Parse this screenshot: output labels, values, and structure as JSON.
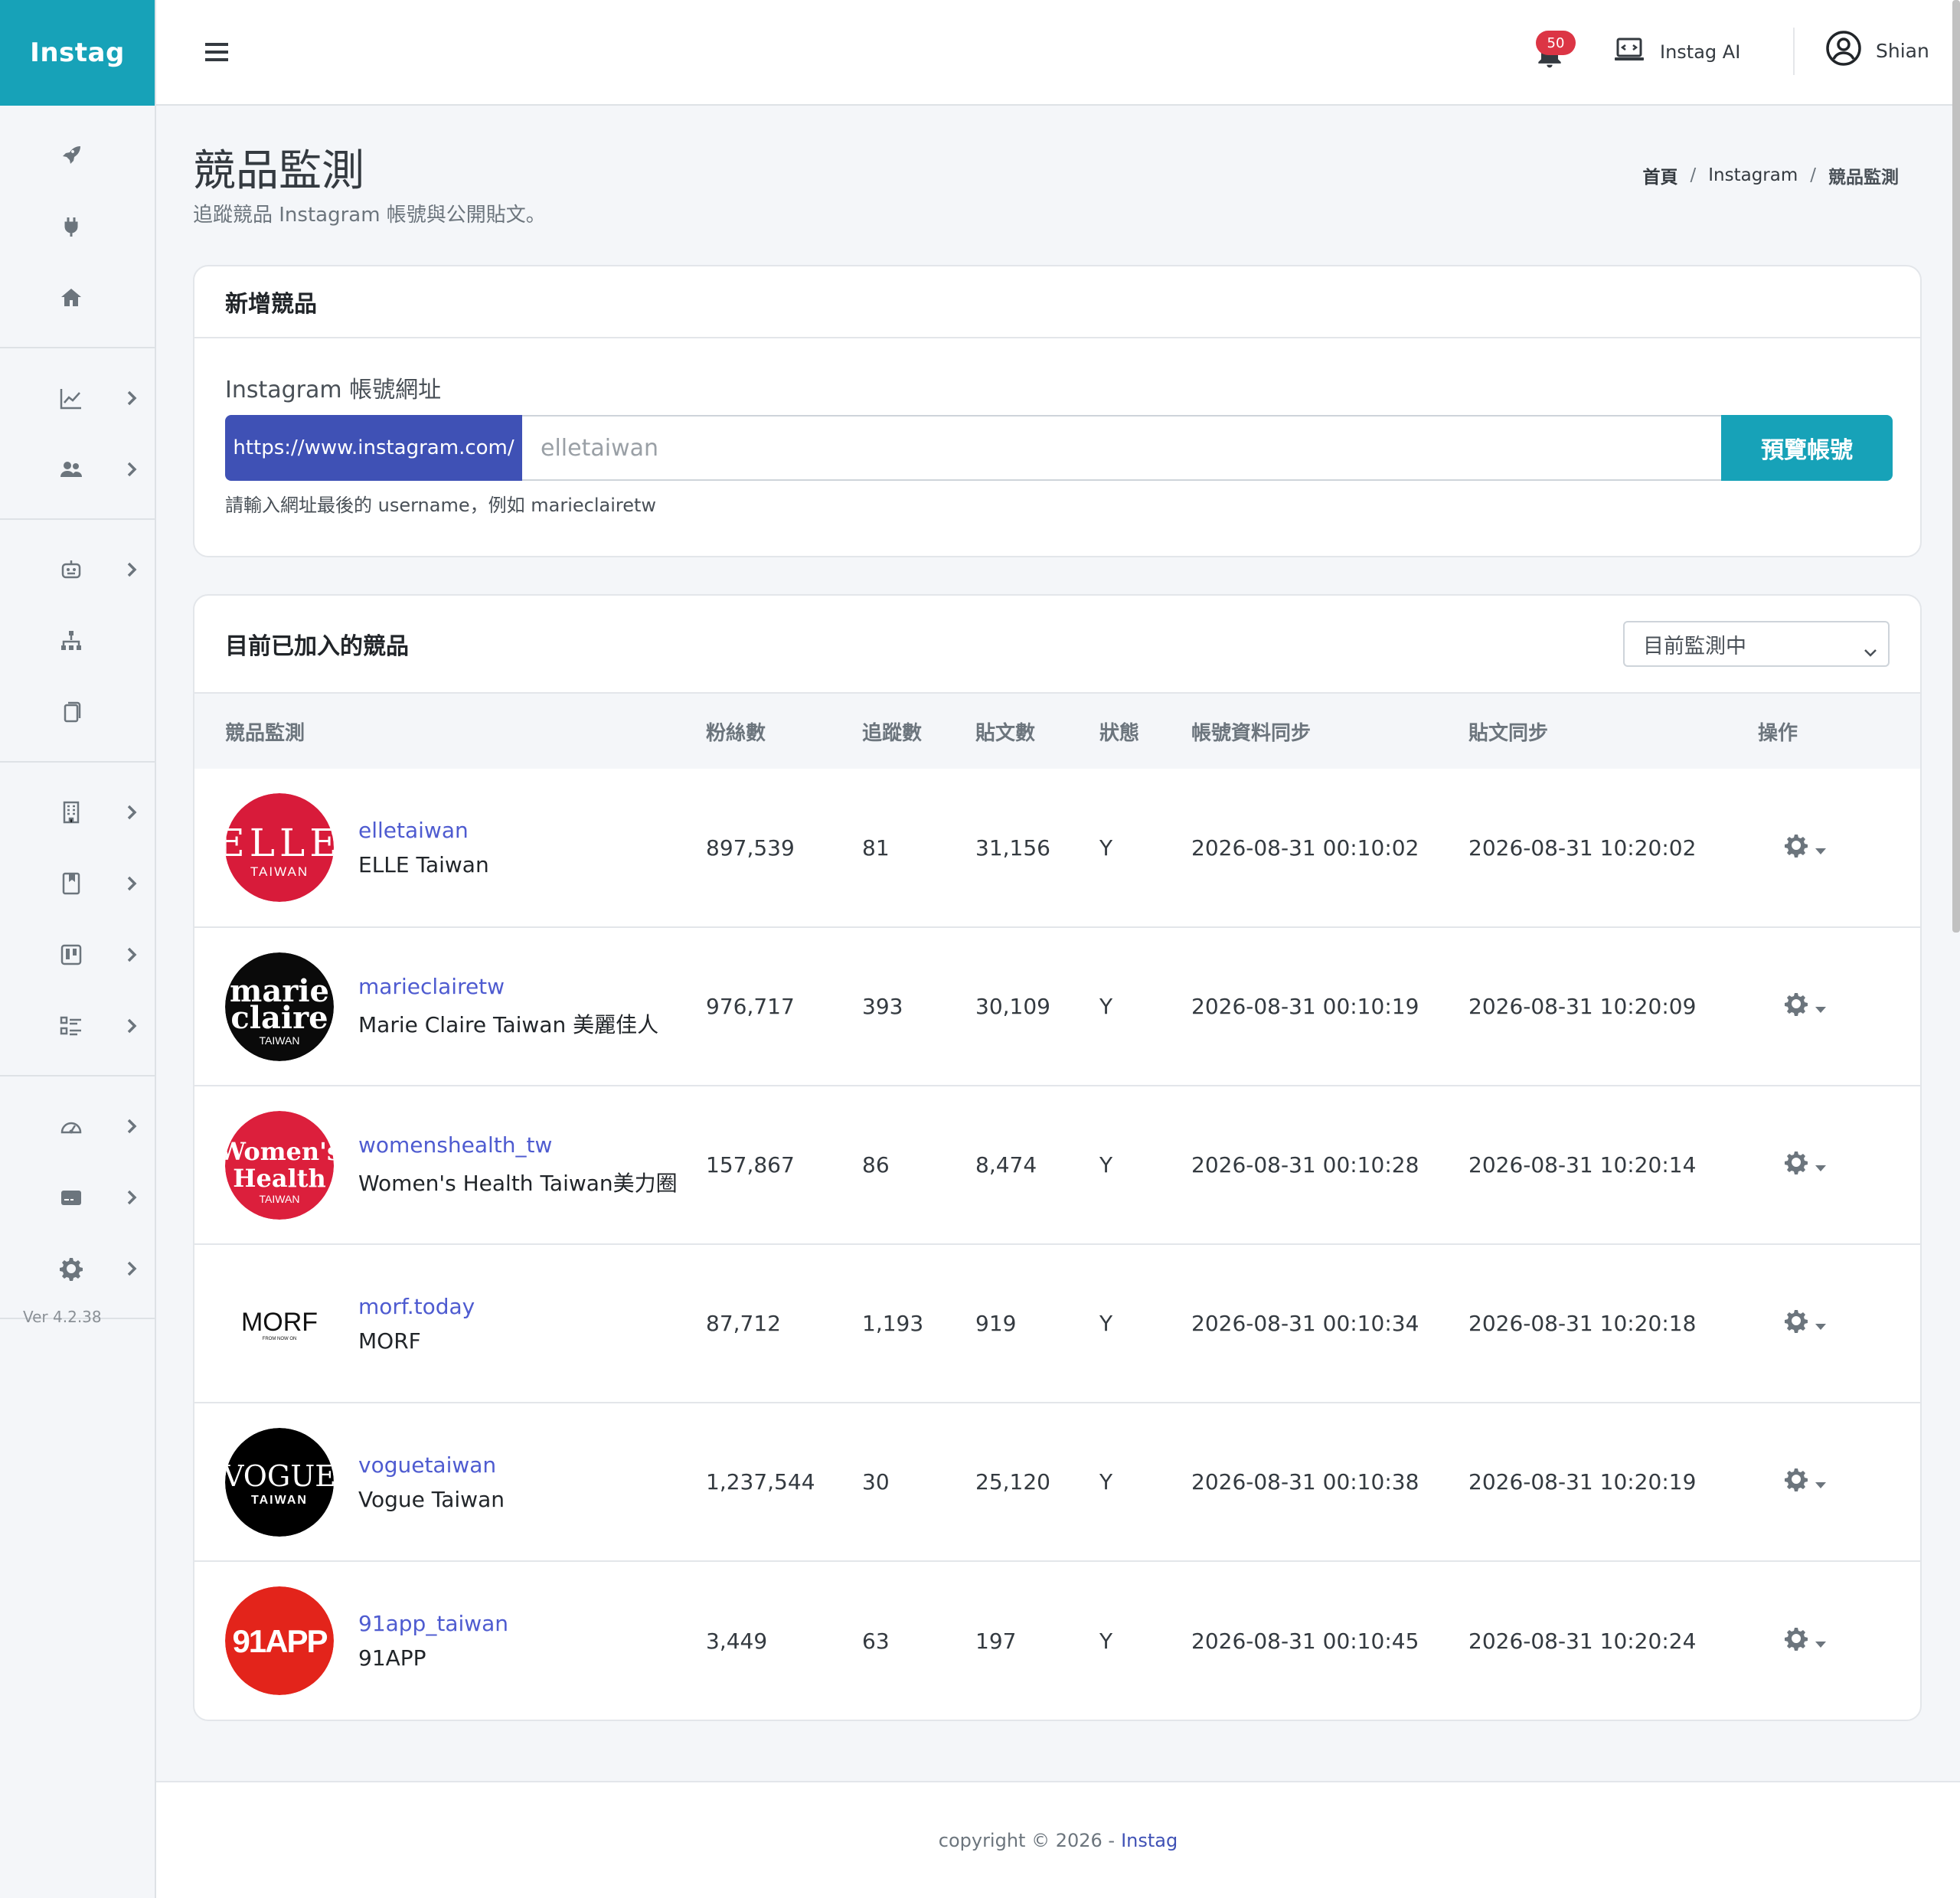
{
  "app": {
    "brand": "Instag",
    "version": "Ver 4.2.38"
  },
  "topbar": {
    "notification_count": "50",
    "ai_label": "Instag AI",
    "user_name": "Shian"
  },
  "sidebar": {
    "items": [
      {
        "icon": "rocket-icon",
        "chevron": false
      },
      {
        "icon": "plug-icon",
        "chevron": false
      },
      {
        "icon": "home-icon",
        "chevron": false
      },
      {
        "icon": "chart-line-icon",
        "chevron": true
      },
      {
        "icon": "users-icon",
        "chevron": true
      },
      {
        "icon": "robot-icon",
        "chevron": true
      },
      {
        "icon": "sitemap-icon",
        "chevron": false
      },
      {
        "icon": "copy-icon",
        "chevron": false
      },
      {
        "icon": "building-icon",
        "chevron": true
      },
      {
        "icon": "bookmark-book-icon",
        "chevron": true
      },
      {
        "icon": "board-icon",
        "chevron": true
      },
      {
        "icon": "checklist-icon",
        "chevron": true
      },
      {
        "icon": "gauge-icon",
        "chevron": true
      },
      {
        "icon": "credit-card-icon",
        "chevron": true
      },
      {
        "icon": "gear-icon",
        "chevron": true
      }
    ]
  },
  "page": {
    "title": "競品監測",
    "subtitle": "追蹤競品 Instagram 帳號與公開貼文。",
    "breadcrumb": [
      "首頁",
      "Instagram",
      "競品監測"
    ]
  },
  "add_competitor": {
    "title": "新增競品",
    "field_label": "Instagram 帳號網址",
    "prefix": "https://www.instagram.com/",
    "input_placeholder": "elletaiwan",
    "input_value": "",
    "button_label": "預覽帳號",
    "help_text": "請輸入網址最後的 username，例如 marieclairetw"
  },
  "competitor_list": {
    "title": "目前已加入的競品",
    "filter_selected": "目前監測中",
    "columns": [
      "競品監測",
      "粉絲數",
      "追蹤數",
      "貼文數",
      "狀態",
      "帳號資料同步",
      "貼文同步",
      "操作"
    ],
    "rows": [
      {
        "handle": "elletaiwan",
        "name": "ELLE Taiwan",
        "fans": "897,539",
        "following": "81",
        "posts": "31,156",
        "status": "Y",
        "profile_sync": "2026-08-31 00:10:02",
        "post_sync": "2026-08-31 10:20:02",
        "logo": {
          "top": "ELLE",
          "bottom": "TAIWAN",
          "bg": "#d81b3a",
          "fg": "#ffffff"
        }
      },
      {
        "handle": "marieclairetw",
        "name": "Marie Claire Taiwan 美麗佳人",
        "fans": "976,717",
        "following": "393",
        "posts": "30,109",
        "status": "Y",
        "profile_sync": "2026-08-31 00:10:19",
        "post_sync": "2026-08-31 10:20:09",
        "logo": {
          "top": "marie",
          "mid": "claire",
          "bottom": "TAIWAN",
          "bg": "#0a0a0a",
          "fg": "#ffffff"
        }
      },
      {
        "handle": "womenshealth_tw",
        "name": "Women's Health Taiwan美力圈",
        "fans": "157,867",
        "following": "86",
        "posts": "8,474",
        "status": "Y",
        "profile_sync": "2026-08-31 00:10:28",
        "post_sync": "2026-08-31 10:20:14",
        "logo": {
          "top": "Women's",
          "mid": "Health",
          "bottom": "TAIWAN",
          "bg": "#dc1f3c",
          "fg": "#ffffff"
        }
      },
      {
        "handle": "morf.today",
        "name": "MORF",
        "fans": "87,712",
        "following": "1,193",
        "posts": "919",
        "status": "Y",
        "profile_sync": "2026-08-31 00:10:34",
        "post_sync": "2026-08-31 10:20:18",
        "logo": {
          "top": "MORF",
          "bottom": "FROM NOW ON",
          "bg": "#ffffff",
          "fg": "#111111"
        }
      },
      {
        "handle": "voguetaiwan",
        "name": "Vogue Taiwan",
        "fans": "1,237,544",
        "following": "30",
        "posts": "25,120",
        "status": "Y",
        "profile_sync": "2026-08-31 00:10:38",
        "post_sync": "2026-08-31 10:20:19",
        "logo": {
          "top": "VOGUE",
          "bottom": "TAIWAN",
          "bg": "#000000",
          "fg": "#ffffff"
        }
      },
      {
        "handle": "91app_taiwan",
        "name": "91APP",
        "fans": "3,449",
        "following": "63",
        "posts": "197",
        "status": "Y",
        "profile_sync": "2026-08-31 00:10:45",
        "post_sync": "2026-08-31 10:20:24",
        "logo": {
          "top": "91APP",
          "bg": "#e3241b",
          "fg": "#ffffff"
        }
      }
    ]
  },
  "footer": {
    "text": "copyright © 2026 -",
    "link": "Instag"
  },
  "colors": {
    "brand": "#17a2b8",
    "primary": "#3f51b5",
    "link": "#4e5bd0",
    "danger": "#dc3545"
  }
}
